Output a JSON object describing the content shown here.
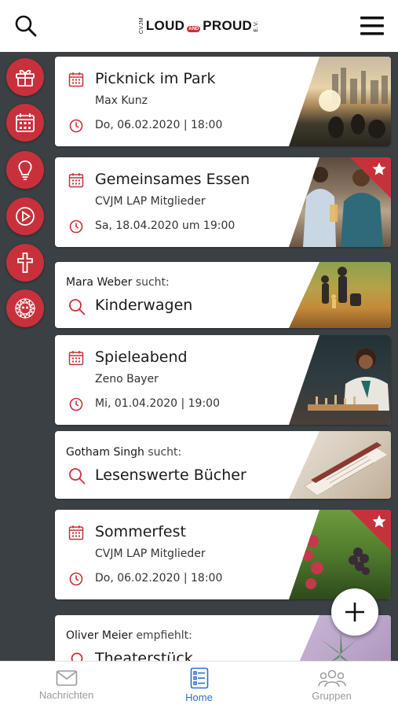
{
  "header": {
    "logo": {
      "prefix": "CVJM",
      "word1": "LOUD",
      "and": "AND",
      "word2": "PROUD",
      "suffix": "E.V."
    },
    "search_icon": "search-icon",
    "menu_icon": "hamburger-menu-icon"
  },
  "sidebar": {
    "items": [
      {
        "name": "gift",
        "icon": "gift-icon"
      },
      {
        "name": "calendar",
        "icon": "calendar-icon"
      },
      {
        "name": "ideas",
        "icon": "lightbulb-icon"
      },
      {
        "name": "media",
        "icon": "play-icon"
      },
      {
        "name": "faith",
        "icon": "cross-icon"
      },
      {
        "name": "community",
        "icon": "lion-emblem-icon"
      }
    ]
  },
  "cards": [
    {
      "type": "event",
      "title": "Picknick im Park",
      "organizer": "Max Kunz",
      "date": "Do, 06.02.2020 | 18:00",
      "starred": false
    },
    {
      "type": "event",
      "title": "Gemeinsames Essen",
      "organizer": "CVJM LAP Mitglieder",
      "date": "Sa, 18.04.2020 um 19:00",
      "starred": true
    },
    {
      "type": "search",
      "person": "Mara Weber",
      "verb": "sucht:",
      "title": "Kinderwagen"
    },
    {
      "type": "event",
      "title": "Spieleabend",
      "organizer": "Zeno Bayer",
      "date": "Mi, 01.04.2020 | 19:00",
      "starred": false
    },
    {
      "type": "search",
      "person": "Gotham Singh",
      "verb": "sucht:",
      "title": "Lesenswerte Bücher"
    },
    {
      "type": "event",
      "title": "Sommerfest",
      "organizer": "CVJM LAP Mitglieder",
      "date": "Do, 06.02.2020 | 18:00",
      "starred": true
    },
    {
      "type": "recommend",
      "person": "Oliver Meier",
      "verb": "empfiehlt:",
      "title": "Theaterstück"
    }
  ],
  "fab": {
    "icon": "plus-icon"
  },
  "bottom_nav": {
    "items": [
      {
        "label": "Nachrichten",
        "icon": "mail-icon",
        "active": false
      },
      {
        "label": "Home",
        "icon": "list-icon",
        "active": true
      },
      {
        "label": "Gruppen",
        "icon": "group-icon",
        "active": false
      }
    ]
  },
  "colors": {
    "accent": "#c8313b",
    "active_nav": "#2a6fd6",
    "background": "#3b4044"
  }
}
